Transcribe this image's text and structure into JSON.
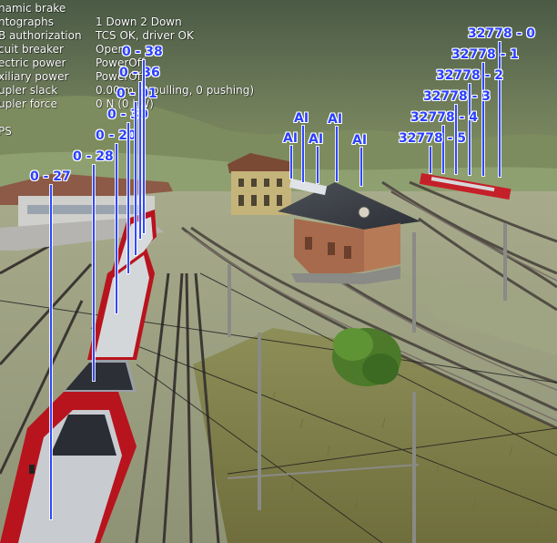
{
  "hud": {
    "rows": [
      {
        "label": "namic brake",
        "value": ""
      },
      {
        "label": "ntographs",
        "value": "1 Down 2 Down"
      },
      {
        "label": "B authorization",
        "value": "TCS OK, driver OK"
      },
      {
        "label": "cuit breaker",
        "value": "Open"
      },
      {
        "label": "ectric power",
        "value": "PowerOff"
      },
      {
        "label": "xiliary power",
        "value": "PowerOff"
      },
      {
        "label": "upler slack",
        "value": "0.00 m (0 pulling, 0 pushing)"
      },
      {
        "label": "upler force",
        "value": "0 N (0 kW)"
      },
      {
        "label": "PS",
        "value": ""
      }
    ]
  },
  "labels": {
    "train_cars": [
      "0 - 27",
      "0 - 28",
      "0 - 20",
      "0 - 30",
      "0 - 01",
      "0 - 36",
      "0 - 38"
    ],
    "ai": [
      "AI",
      "AI",
      "AI",
      "AI",
      "AI",
      "AI"
    ],
    "distant_train": [
      "32778 - 0",
      "32778 - 1",
      "32778 - 2",
      "32778 - 3",
      "32778 - 4",
      "32778 - 5"
    ]
  },
  "colors": {
    "label_text": "#2b40ff",
    "label_outline": "#ffffff",
    "hud_text": "#ffffff",
    "train_red": "#b8141e"
  }
}
